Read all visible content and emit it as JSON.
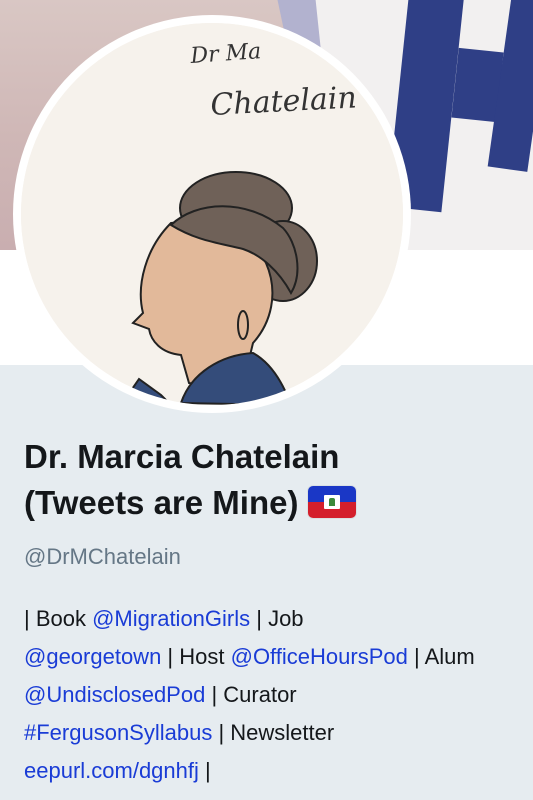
{
  "profile": {
    "name_line1": "Dr. Marcia Chatelain",
    "name_line2": "(Tweets are Mine)",
    "flag_icon": "haiti-flag-icon",
    "handle": "@DrMChatelain"
  },
  "avatar": {
    "handwriting_line1": "Dr Ma",
    "handwriting_line2": "Chatelain"
  },
  "bio": {
    "t1": "| Book ",
    "l1": "@MigrationGirls",
    "t2": " | Job ",
    "l2": "@georgetown",
    "t3": " | Host ",
    "l3": "@OfficeHoursPod",
    "t4": " | Alum ",
    "l4": "@UndisclosedPod",
    "t5": " | Curator ",
    "l5": "#FergusonSyllabus",
    "t6": " | Newsletter ",
    "l6": "eepurl.com/dgnhfj",
    "t7": " |"
  },
  "colors": {
    "background": "#e6ecf0",
    "link": "#1a3cd6",
    "handle": "#657786",
    "text": "#14171a"
  }
}
